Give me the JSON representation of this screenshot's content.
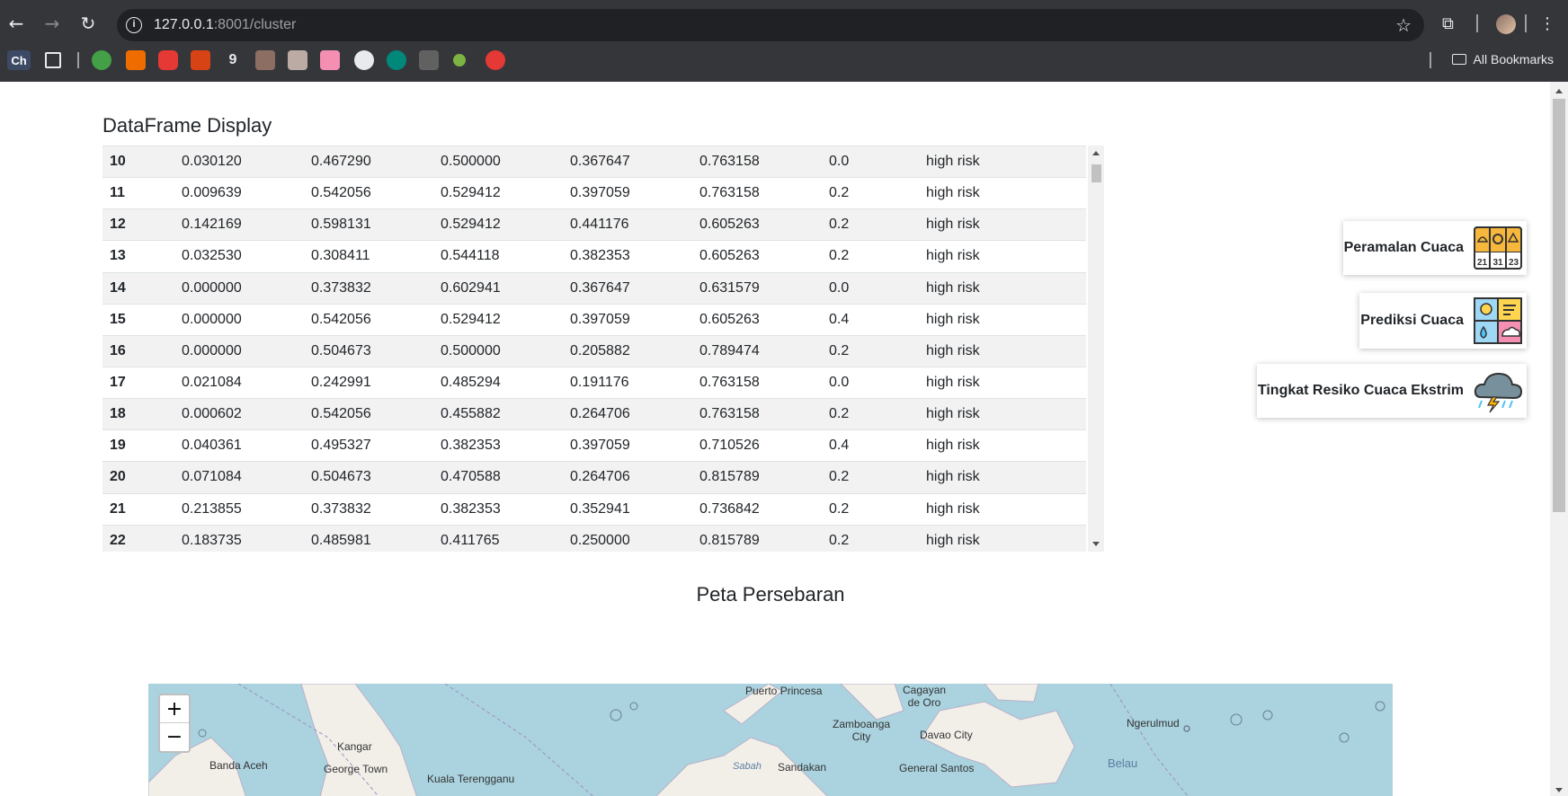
{
  "browser": {
    "url_host": "127.0.0.1",
    "url_rest": ":8001/cluster",
    "bookmark_ch": "Ch",
    "all_bookmarks": "All Bookmarks"
  },
  "page": {
    "dataframe_title": "DataFrame Display",
    "map_title": "Peta Persebaran"
  },
  "table": {
    "rows": [
      [
        "10",
        "0.030120",
        "0.467290",
        "0.500000",
        "0.367647",
        "0.763158",
        "0.0",
        "high risk"
      ],
      [
        "11",
        "0.009639",
        "0.542056",
        "0.529412",
        "0.397059",
        "0.763158",
        "0.2",
        "high risk"
      ],
      [
        "12",
        "0.142169",
        "0.598131",
        "0.529412",
        "0.441176",
        "0.605263",
        "0.2",
        "high risk"
      ],
      [
        "13",
        "0.032530",
        "0.308411",
        "0.544118",
        "0.382353",
        "0.605263",
        "0.2",
        "high risk"
      ],
      [
        "14",
        "0.000000",
        "0.373832",
        "0.602941",
        "0.367647",
        "0.631579",
        "0.0",
        "high risk"
      ],
      [
        "15",
        "0.000000",
        "0.542056",
        "0.529412",
        "0.397059",
        "0.605263",
        "0.4",
        "high risk"
      ],
      [
        "16",
        "0.000000",
        "0.504673",
        "0.500000",
        "0.205882",
        "0.789474",
        "0.2",
        "high risk"
      ],
      [
        "17",
        "0.021084",
        "0.242991",
        "0.485294",
        "0.191176",
        "0.763158",
        "0.0",
        "high risk"
      ],
      [
        "18",
        "0.000602",
        "0.542056",
        "0.455882",
        "0.264706",
        "0.763158",
        "0.2",
        "high risk"
      ],
      [
        "19",
        "0.040361",
        "0.495327",
        "0.382353",
        "0.397059",
        "0.710526",
        "0.4",
        "high risk"
      ],
      [
        "20",
        "0.071084",
        "0.504673",
        "0.470588",
        "0.264706",
        "0.815789",
        "0.2",
        "high risk"
      ],
      [
        "21",
        "0.213855",
        "0.373832",
        "0.382353",
        "0.352941",
        "0.736842",
        "0.2",
        "high risk"
      ],
      [
        "22",
        "0.183735",
        "0.485981",
        "0.411765",
        "0.250000",
        "0.815789",
        "0.2",
        "high risk"
      ]
    ]
  },
  "cards": {
    "peramalan": "Peramalan Cuaca",
    "prediksi": "Prediksi Cuaca",
    "resiko": "Tingkat Resiko Cuaca Ekstrim",
    "peramalan_icon_dates": [
      "21",
      "31",
      "23"
    ]
  },
  "map": {
    "zoom_in": "+",
    "zoom_out": "−",
    "places": {
      "puerto_princesa": "Puerto Princesa",
      "cagayan": "Cagayan\nde Oro",
      "zamboanga": "Zamboanga\nCity",
      "davao": "Davao City",
      "ngerulmud": "Ngerulmud",
      "kangar": "Kangar",
      "banda_aceh": "Banda Aceh",
      "george_town": "George Town",
      "kuala_terengganu": "Kuala Terengganu",
      "sabah": "Sabah",
      "sandakan": "Sandakan",
      "general_santos": "General Santos",
      "belau": "Belau"
    }
  },
  "colors": {
    "row_stripe": "#f2f2f2",
    "map_water": "#aad3df",
    "map_land": "#f2efe9"
  }
}
